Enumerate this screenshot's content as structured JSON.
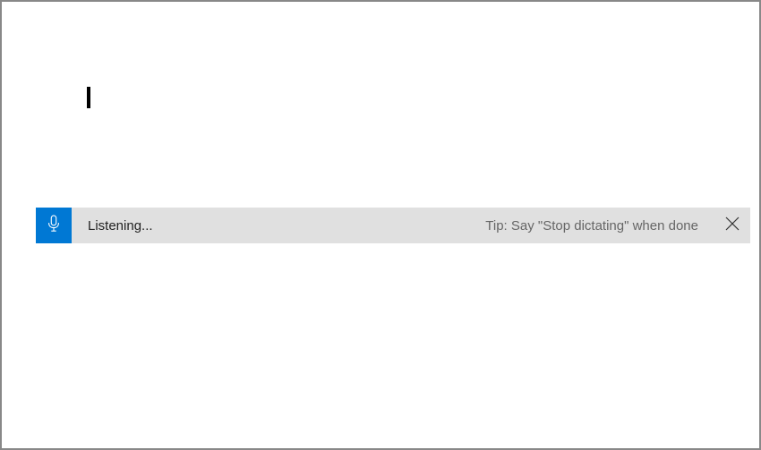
{
  "dictation": {
    "status_text": "Listening...",
    "tip_text": "Tip: Say \"Stop dictating\" when done",
    "mic_color": "#0078d4"
  },
  "document": {
    "content": ""
  }
}
